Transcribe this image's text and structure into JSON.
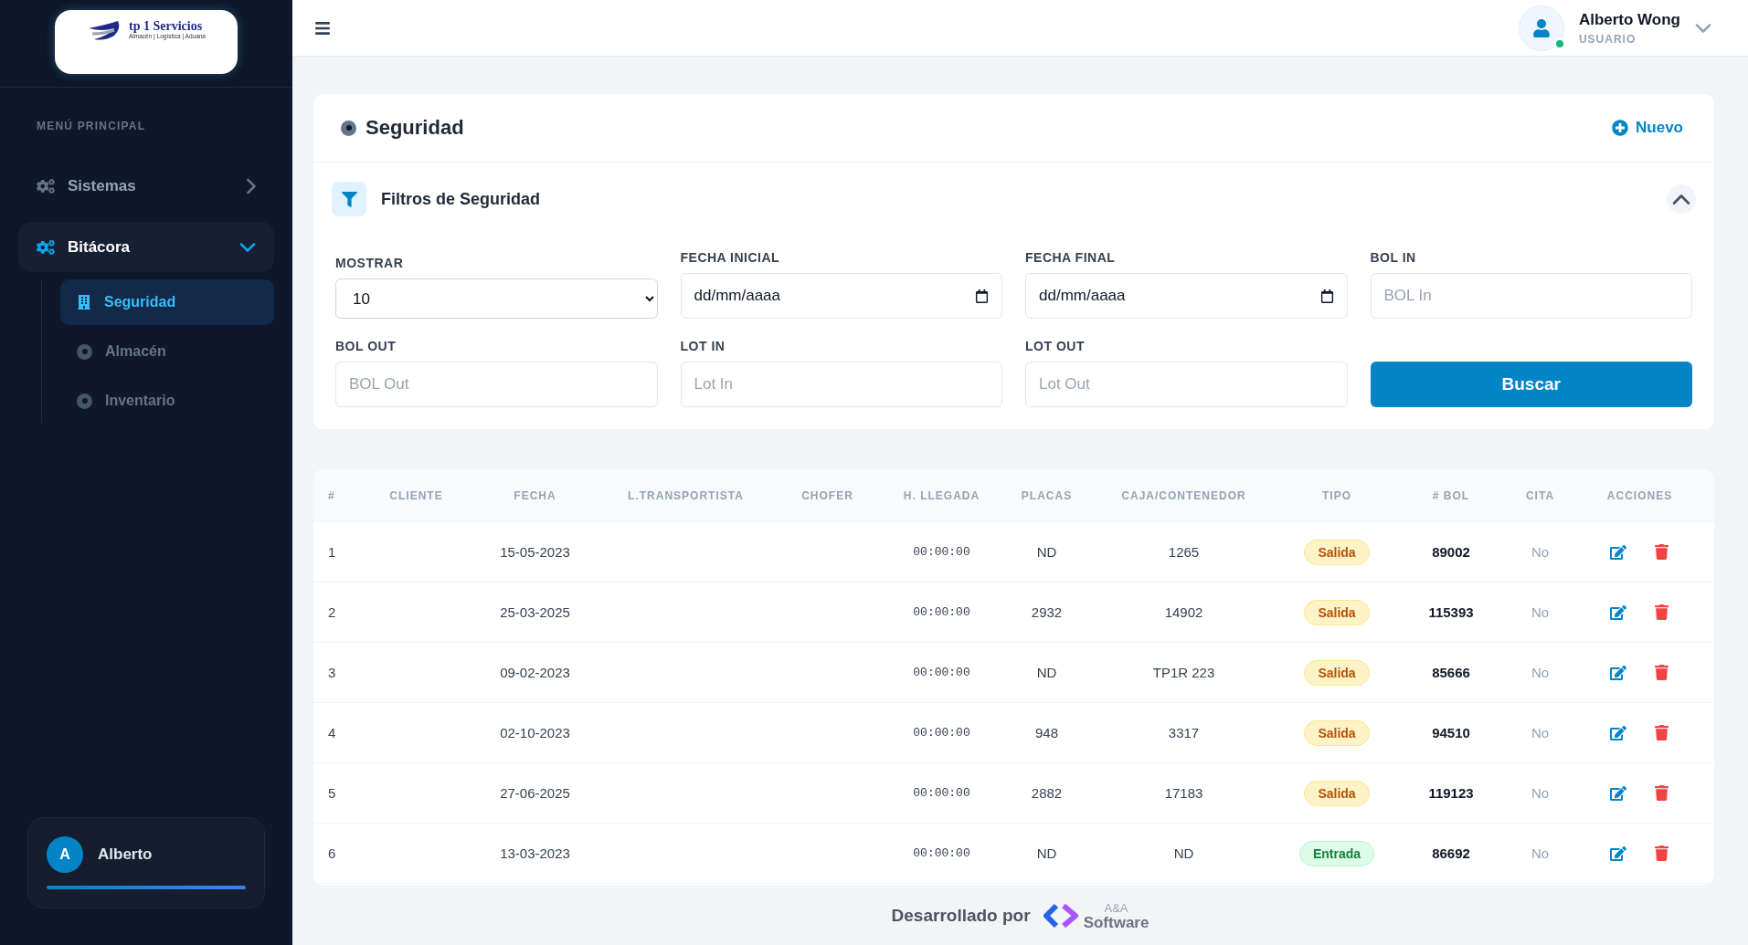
{
  "sidebar": {
    "logo": {
      "title": "tp 1 Servicios",
      "tagline": "Almacén | Logística | Aduana"
    },
    "section_label": "MENÚ PRINCIPAL",
    "items": [
      {
        "label": "Sistemas",
        "expanded": false
      },
      {
        "label": "Bitácora",
        "expanded": true,
        "children": [
          {
            "label": "Seguridad",
            "selected": true
          },
          {
            "label": "Almacén",
            "selected": false
          },
          {
            "label": "Inventario",
            "selected": false
          }
        ]
      }
    ],
    "user_card": {
      "initial": "A",
      "name": "Alberto"
    }
  },
  "header": {
    "user": {
      "name": "Alberto Wong",
      "role": "USUARIO",
      "online": true
    }
  },
  "page": {
    "title": "Seguridad",
    "new_button": "Nuevo"
  },
  "filters": {
    "title": "Filtros de Seguridad",
    "expanded": true,
    "fields": [
      {
        "kind": "select",
        "label": "MOSTRAR",
        "value": "10"
      },
      {
        "kind": "date",
        "label": "FECHA INICIAL",
        "placeholder": "dd/mm/aaaa"
      },
      {
        "kind": "date",
        "label": "FECHA FINAL",
        "placeholder": "dd/mm/aaaa"
      },
      {
        "kind": "text",
        "label": "BOL IN",
        "placeholder": "BOL In"
      },
      {
        "kind": "text",
        "label": "BOL OUT",
        "placeholder": "BOL Out"
      },
      {
        "kind": "text",
        "label": "LOT IN",
        "placeholder": "Lot In"
      },
      {
        "kind": "text",
        "label": "LOT OUT",
        "placeholder": "Lot Out"
      },
      {
        "kind": "button",
        "label": "Buscar"
      }
    ]
  },
  "table": {
    "columns": [
      "#",
      "CLIENTE",
      "FECHA",
      "L.TRANSPORTISTA",
      "CHOFER",
      "H. LLEGADA",
      "PLACAS",
      "CAJA/CONTENEDOR",
      "TIPO",
      "# BOL",
      "CITA",
      "ACCIONES"
    ],
    "rows": [
      {
        "n": "1",
        "fecha": "15-05-2023",
        "llegada": "00:00:00",
        "placas": "ND",
        "caja": "1265",
        "tipo": {
          "label": "Salida",
          "kind": "salida"
        },
        "bol": "89002",
        "cita": "No"
      },
      {
        "n": "2",
        "fecha": "25-03-2025",
        "llegada": "00:00:00",
        "placas": "2932",
        "caja": "14902",
        "tipo": {
          "label": "Salida",
          "kind": "salida"
        },
        "bol": "115393",
        "cita": "No"
      },
      {
        "n": "3",
        "fecha": "09-02-2023",
        "llegada": "00:00:00",
        "placas": "ND",
        "caja": "TP1R 223",
        "tipo": {
          "label": "Salida",
          "kind": "salida"
        },
        "bol": "85666",
        "cita": "No"
      },
      {
        "n": "4",
        "fecha": "02-10-2023",
        "llegada": "00:00:00",
        "placas": "948",
        "caja": "3317",
        "tipo": {
          "label": "Salida",
          "kind": "salida"
        },
        "bol": "94510",
        "cita": "No"
      },
      {
        "n": "5",
        "fecha": "27-06-2025",
        "llegada": "00:00:00",
        "placas": "2882",
        "caja": "17183",
        "tipo": {
          "label": "Salida",
          "kind": "salida"
        },
        "bol": "119123",
        "cita": "No"
      },
      {
        "n": "6",
        "fecha": "13-03-2023",
        "llegada": "00:00:00",
        "placas": "ND",
        "caja": "ND",
        "tipo": {
          "label": "Entrada",
          "kind": "entrada"
        },
        "bol": "86692",
        "cita": "No"
      }
    ]
  },
  "footer": {
    "text": "Desarrollado por",
    "brand_top": "A&A",
    "brand_bottom": "Software"
  }
}
